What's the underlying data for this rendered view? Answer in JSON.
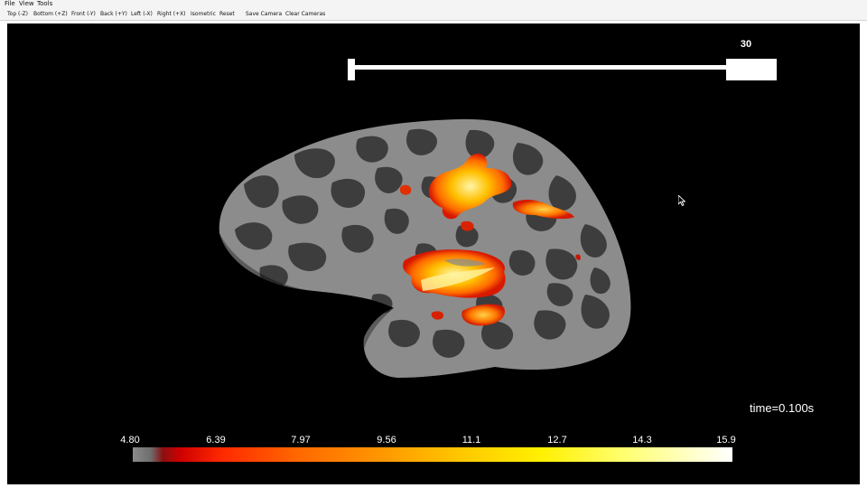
{
  "menubar": {
    "items": [
      "File",
      "View",
      "Tools"
    ]
  },
  "toolbar": {
    "buttons": [
      "Top (-Z)",
      "Bottom (+Z)",
      "Front (-Y)",
      "Back (+Y)",
      "Left (-X)",
      "Right (+X)",
      "Isometric",
      "Reset",
      "Save Camera",
      "Clear Cameras"
    ]
  },
  "viewer": {
    "slider_value": "30",
    "time_label": "time=0.100s",
    "colorbar": {
      "ticks": [
        "4.80",
        "6.39",
        "7.97",
        "9.56",
        "11.1",
        "12.7",
        "14.3",
        "15.9"
      ],
      "colors": [
        "#8a8a8a",
        "#d00000",
        "#ff6a00",
        "#ffcc00",
        "#ffff70",
        "#ffffff"
      ]
    },
    "background_color": "#000000"
  }
}
